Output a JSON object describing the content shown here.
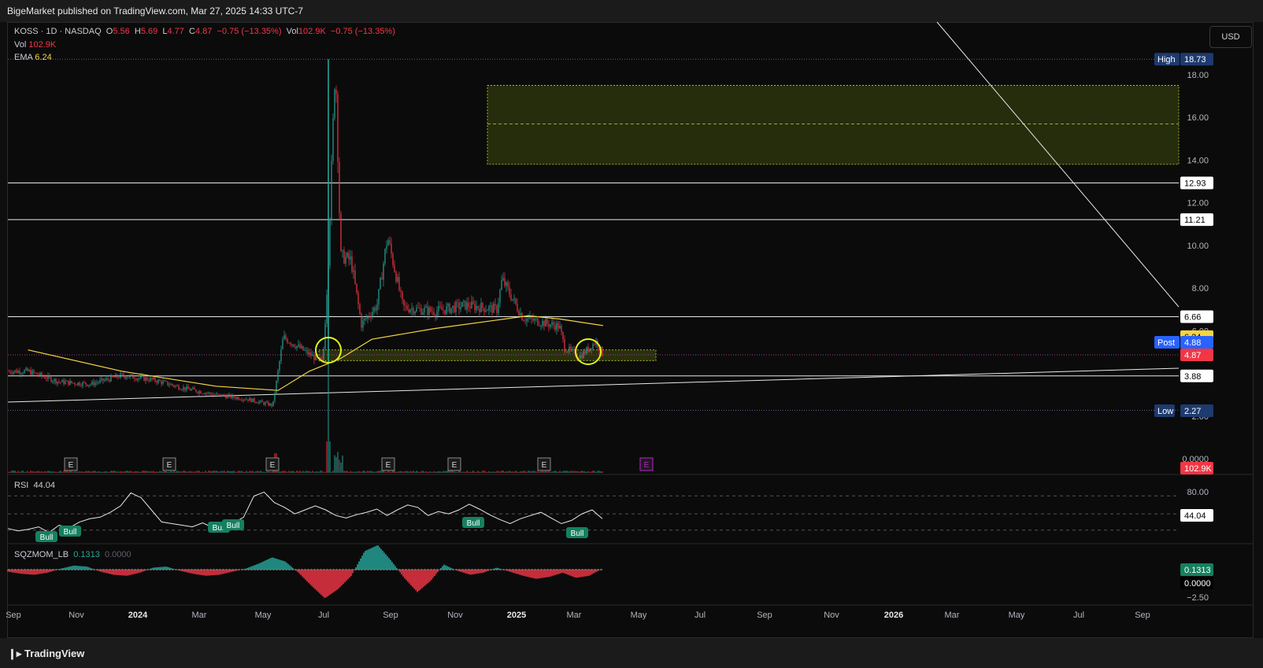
{
  "header": {
    "published": "BigeMarket published on TradingView.com, Mar 27, 2025 14:33 UTC-7"
  },
  "legend": {
    "symbol": "KOSS · 1D · NASDAQ",
    "o_label": "O",
    "o": "5.56",
    "h_label": "H",
    "h": "5.69",
    "l_label": "L",
    "l": "4.77",
    "c_label": "C",
    "c": "4.87",
    "chg": "−0.75 (−13.35%)",
    "vol_label": "Vol",
    "vol": "102.9K",
    "vol_chg": "−0.75 (−13.35%)",
    "vol_row_label": "Vol",
    "vol_row_value": "102.9K",
    "ema_label": "EMA",
    "ema_value": "6.24",
    "rsi_label": "RSI",
    "rsi_value": "44.04",
    "sqz_label": "SQZMOM_LB",
    "sqz_value": "0.1313",
    "sqz_value2": "0.0000"
  },
  "currency_button": "USD",
  "footer": {
    "brand": "TradingView"
  },
  "colors": {
    "up": "#26a69a",
    "down": "#f23645",
    "ema": "#f5d442",
    "zone": "#3d4a10",
    "bg": "#0b0b0b"
  },
  "chart_data": {
    "type": "line",
    "title": "KOSS · 1D · NASDAQ",
    "x_axis_ticks": [
      "Sep",
      "Nov",
      "2024",
      "Mar",
      "May",
      "Jul",
      "Sep",
      "Nov",
      "2025",
      "Mar",
      "May",
      "Jul",
      "Sep",
      "Nov",
      "2026",
      "Mar",
      "May",
      "Jul",
      "Sep"
    ],
    "price_axis_ticks": [
      "18.00",
      "16.00",
      "14.00",
      "12.00",
      "10.00",
      "8.00",
      "6.00",
      "4.00",
      "2.00",
      "0.0000"
    ],
    "price_labels": [
      {
        "name": "High",
        "value": "18.73"
      },
      {
        "value": "12.93"
      },
      {
        "value": "11.21"
      },
      {
        "value": "6.66"
      },
      {
        "value": "6.24"
      },
      {
        "name": "Post",
        "value": "4.88"
      },
      {
        "value": "4.87"
      },
      {
        "value": "3.88"
      },
      {
        "name": "Low",
        "value": "2.27"
      },
      {
        "value": "102.9K"
      }
    ],
    "horizontal_levels": [
      12.93,
      11.21,
      6.66,
      3.88
    ],
    "target_zone": {
      "from": 13.8,
      "to": 17.5,
      "mid": 15.7
    },
    "support_zone": {
      "from": 4.6,
      "to": 5.1
    },
    "earnings_marker": "E",
    "price_series": [
      [
        "2023-09",
        4.1
      ],
      [
        "2023-10",
        3.6
      ],
      [
        "2023-11",
        3.5
      ],
      [
        "2023-12",
        3.9
      ],
      [
        "2024-01",
        3.7
      ],
      [
        "2024-02",
        3.3
      ],
      [
        "2024-03",
        3.0
      ],
      [
        "2024-04",
        2.8
      ],
      [
        "2024-05-10",
        2.5
      ],
      [
        "2024-05-20",
        5.7
      ],
      [
        "2024-06",
        4.9
      ],
      [
        "2024-06-28",
        4.5
      ],
      [
        "2024-07-03",
        9.0
      ],
      [
        "2024-07-10",
        18.73
      ],
      [
        "2024-07-15",
        9.5
      ],
      [
        "2024-07-25",
        9.3
      ],
      [
        "2024-08-05",
        6.3
      ],
      [
        "2024-08-20",
        7.2
      ],
      [
        "2024-08-30",
        10.4
      ],
      [
        "2024-09-15",
        7.1
      ],
      [
        "2024-10",
        6.9
      ],
      [
        "2024-11",
        7.2
      ],
      [
        "2024-12",
        7.0
      ],
      [
        "2024-12-20",
        8.4
      ],
      [
        "2025-01-10",
        6.6
      ],
      [
        "2025-02",
        6.2
      ],
      [
        "2025-02-20",
        5.2
      ],
      [
        "2025-03-05",
        4.8
      ],
      [
        "2025-03-20",
        5.5
      ],
      [
        "2025-03-27",
        4.87
      ]
    ],
    "ema_series": [
      [
        "2023-09",
        5.1
      ],
      [
        "2023-12",
        4.1
      ],
      [
        "2024-03",
        3.4
      ],
      [
        "2024-05",
        3.2
      ],
      [
        "2024-06",
        4.1
      ],
      [
        "2024-07",
        4.7
      ],
      [
        "2024-08",
        5.6
      ],
      [
        "2024-10",
        6.1
      ],
      [
        "2024-12",
        6.5
      ],
      [
        "2025-01",
        6.7
      ],
      [
        "2025-02",
        6.55
      ],
      [
        "2025-03-27",
        6.24
      ]
    ],
    "rsi": {
      "value": 44.04,
      "levels": [
        80.0,
        44.04
      ],
      "signals": [
        "Bull",
        "Bull",
        "Bull",
        "Bull",
        "Bull",
        "Bull"
      ],
      "series": [
        32,
        29,
        31,
        34,
        27,
        36,
        33,
        40,
        44,
        46,
        52,
        60,
        76,
        70,
        55,
        40,
        38,
        36,
        34,
        39,
        33,
        35,
        39,
        46,
        72,
        77,
        64,
        58,
        50,
        55,
        60,
        55,
        48,
        45,
        49,
        52,
        56,
        48,
        55,
        61,
        58,
        48,
        53,
        50,
        55,
        62,
        56,
        49,
        43,
        38,
        44,
        48,
        52,
        45,
        38,
        42,
        50,
        55,
        44
      ]
    },
    "squeeze_momentum": {
      "value": 0.1313,
      "zero": 0.0,
      "axis_ticks": [
        "0.1313",
        "0.0000",
        "−2.50"
      ],
      "series": [
        -0.2,
        -0.4,
        -0.5,
        -0.3,
        0.1,
        0.4,
        0.3,
        -0.2,
        -0.5,
        -0.6,
        -0.3,
        0.2,
        0.3,
        -0.1,
        -0.4,
        -0.6,
        -0.5,
        -0.2,
        0.1,
        0.6,
        1.2,
        0.8,
        -0.3,
        -1.6,
        -2.8,
        -1.9,
        -0.6,
        1.8,
        2.4,
        0.9,
        -0.8,
        -2.2,
        -1.1,
        0.5,
        -0.1,
        -0.5,
        -0.3,
        0.2,
        -0.2,
        -0.6,
        -0.9,
        -0.7,
        -0.3,
        -0.8,
        -0.6,
        0.1
      ]
    }
  }
}
